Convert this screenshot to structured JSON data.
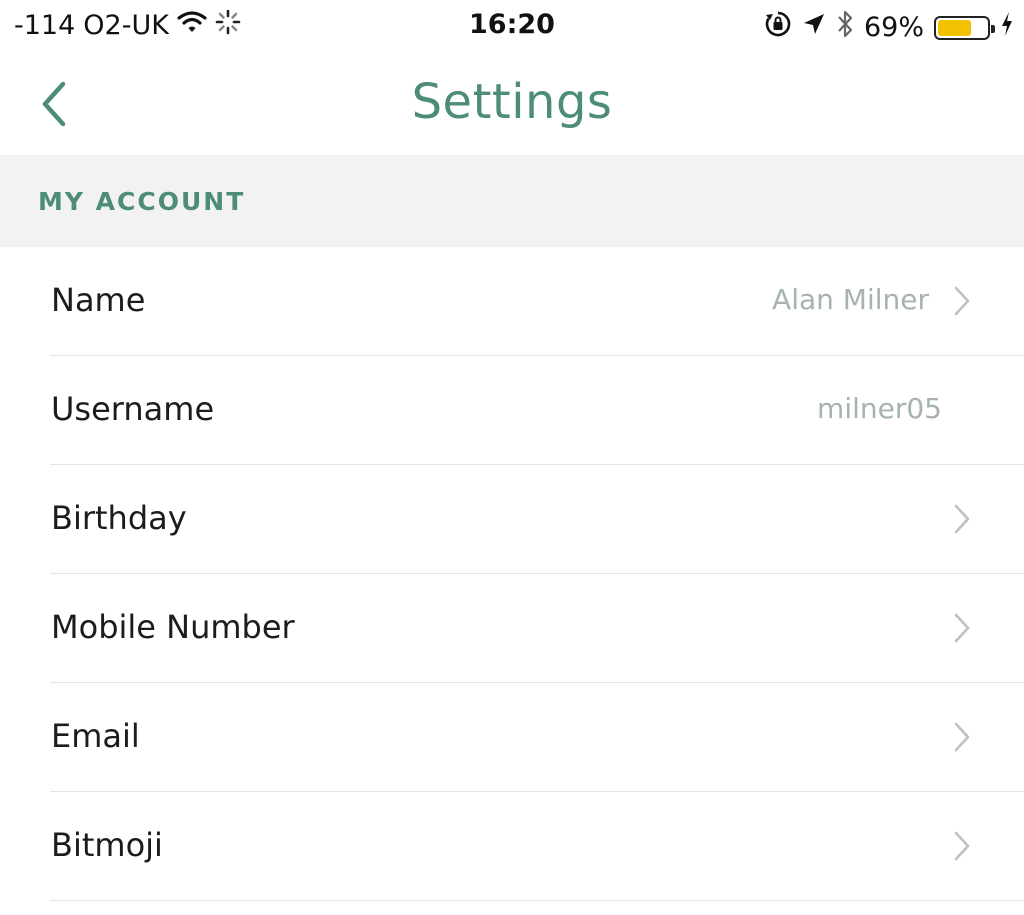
{
  "status_bar": {
    "signal": "-114",
    "carrier": "O2-UK",
    "time": "16:20",
    "battery_percent_label": "69%",
    "battery_level": 0.69,
    "icons": [
      "wifi-icon",
      "activity-spinner-icon",
      "rotation-lock-icon",
      "location-arrow-icon",
      "bluetooth-icon",
      "battery-icon",
      "charging-bolt-icon"
    ]
  },
  "nav": {
    "title": "Settings",
    "back_icon": "chevron-left-icon"
  },
  "section": {
    "title": "MY ACCOUNT"
  },
  "rows": [
    {
      "label": "Name",
      "value": "Alan Milner",
      "chevron": true
    },
    {
      "label": "Username",
      "value": "milner05",
      "chevron": false
    },
    {
      "label": "Birthday",
      "value": "",
      "chevron": true
    },
    {
      "label": "Mobile Number",
      "value": "",
      "chevron": true
    },
    {
      "label": "Email",
      "value": "",
      "chevron": true
    },
    {
      "label": "Bitmoji",
      "value": "",
      "chevron": true
    }
  ],
  "colors": {
    "accent": "#4d8c78",
    "section_bg": "#f1f2f1",
    "value_text": "#a6b3ae",
    "chevron": "#b9c3bf",
    "battery_fill": "#f2c200"
  }
}
